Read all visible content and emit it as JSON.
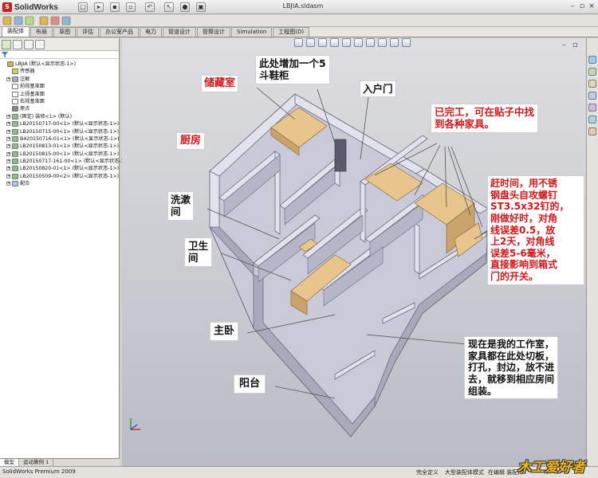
{
  "app": {
    "name": "SolidWorks",
    "window_title": "LBJIA.sldasm"
  },
  "tabs": [
    "装配体",
    "布局",
    "草图",
    "评估",
    "办公室产品",
    "电力",
    "管道设计",
    "管筒设计",
    "Simulation",
    "工程图(D)"
  ],
  "tree": {
    "items": [
      {
        "indent": 0,
        "icon": "assembly-icon",
        "label": "LBJIA  (默认<显示状态-1>)"
      },
      {
        "indent": 1,
        "icon": "sensor-icon",
        "label": "传感器"
      },
      {
        "indent": 1,
        "icon": "annotation-icon",
        "label": "注解",
        "expandable": true
      },
      {
        "indent": 1,
        "icon": "plane-icon",
        "label": "前视基准面"
      },
      {
        "indent": 1,
        "icon": "plane-icon",
        "label": "上视基准面"
      },
      {
        "indent": 1,
        "icon": "plane-icon",
        "label": "右视基准面"
      },
      {
        "indent": 1,
        "icon": "origin-icon",
        "label": "原点"
      },
      {
        "indent": 1,
        "icon": "part-icon",
        "label": "(固定) 装修<1> (默认)",
        "expandable": true
      },
      {
        "indent": 1,
        "icon": "part-icon",
        "label": "LB20150717-00<1> (默认<显示状态-1>)",
        "expandable": true
      },
      {
        "indent": 1,
        "icon": "part-icon",
        "label": "LB20150715-00<1> (默认<显示状态-1>)",
        "expandable": true
      },
      {
        "indent": 1,
        "icon": "part-icon",
        "label": "B420150716-01<1> (默认<显示状态-1>)",
        "expandable": true
      },
      {
        "indent": 1,
        "icon": "part-icon",
        "label": "LB20150813-01<1> (默认<显示状态-1>)",
        "expandable": true
      },
      {
        "indent": 1,
        "icon": "part-icon",
        "label": "LB20150815-00<1> (默认<显示状态-1>)",
        "expandable": true
      },
      {
        "indent": 1,
        "icon": "part-icon",
        "label": "LB20150717-161-00<1> (默认<显示状态-1>)",
        "expandable": true
      },
      {
        "indent": 1,
        "icon": "part-icon",
        "label": "LB20150820-01<1> (默认<显示状态-1>)",
        "expandable": true
      },
      {
        "indent": 1,
        "icon": "part-icon",
        "label": "LB20150509-00<2> (默认<显示状态-1>)",
        "expandable": true
      },
      {
        "indent": 1,
        "icon": "mate-icon",
        "label": "配合",
        "expandable": true
      }
    ],
    "bottom_tabs": [
      "模型",
      "运动算例 1"
    ]
  },
  "annotations": {
    "storage": "储藏室",
    "shoe_cabinet": "此处增加一个5\n斗鞋柜",
    "entrance": "入户门",
    "completed": "已完工，可在贴子中找\n到各种家具。",
    "kitchen": "厨房",
    "hurry": "赶时间，用不锈\n钢盘头自攻螺钉\nST3.5x32钉的，\n刚做好时，对角\n线误差0.5，放\n上2天，对角线\n误差5-6毫米，\n直接影响到箱式\n门的开关。",
    "laundry": "洗漱\n间",
    "bathroom": "卫生\n间",
    "master_bedroom": "主卧",
    "workshop": "现在是我的工作室，\n家具都在此处切板，\n打孔，封边，放不进\n去，就移到相应房间\n组装。",
    "balcony": "阳台"
  },
  "status": {
    "product": "SolidWorks Premium 2009",
    "cells": [
      "完全定义",
      "大型装配体模式",
      "在编辑 装配体"
    ]
  },
  "watermark": "木工爱好者",
  "colors": {
    "wall": "#dcdce6",
    "wall_side": "#a9a9bb",
    "floor": "#c9c9d8",
    "wood": "#e8c58c",
    "note_red": "#d1181b"
  }
}
